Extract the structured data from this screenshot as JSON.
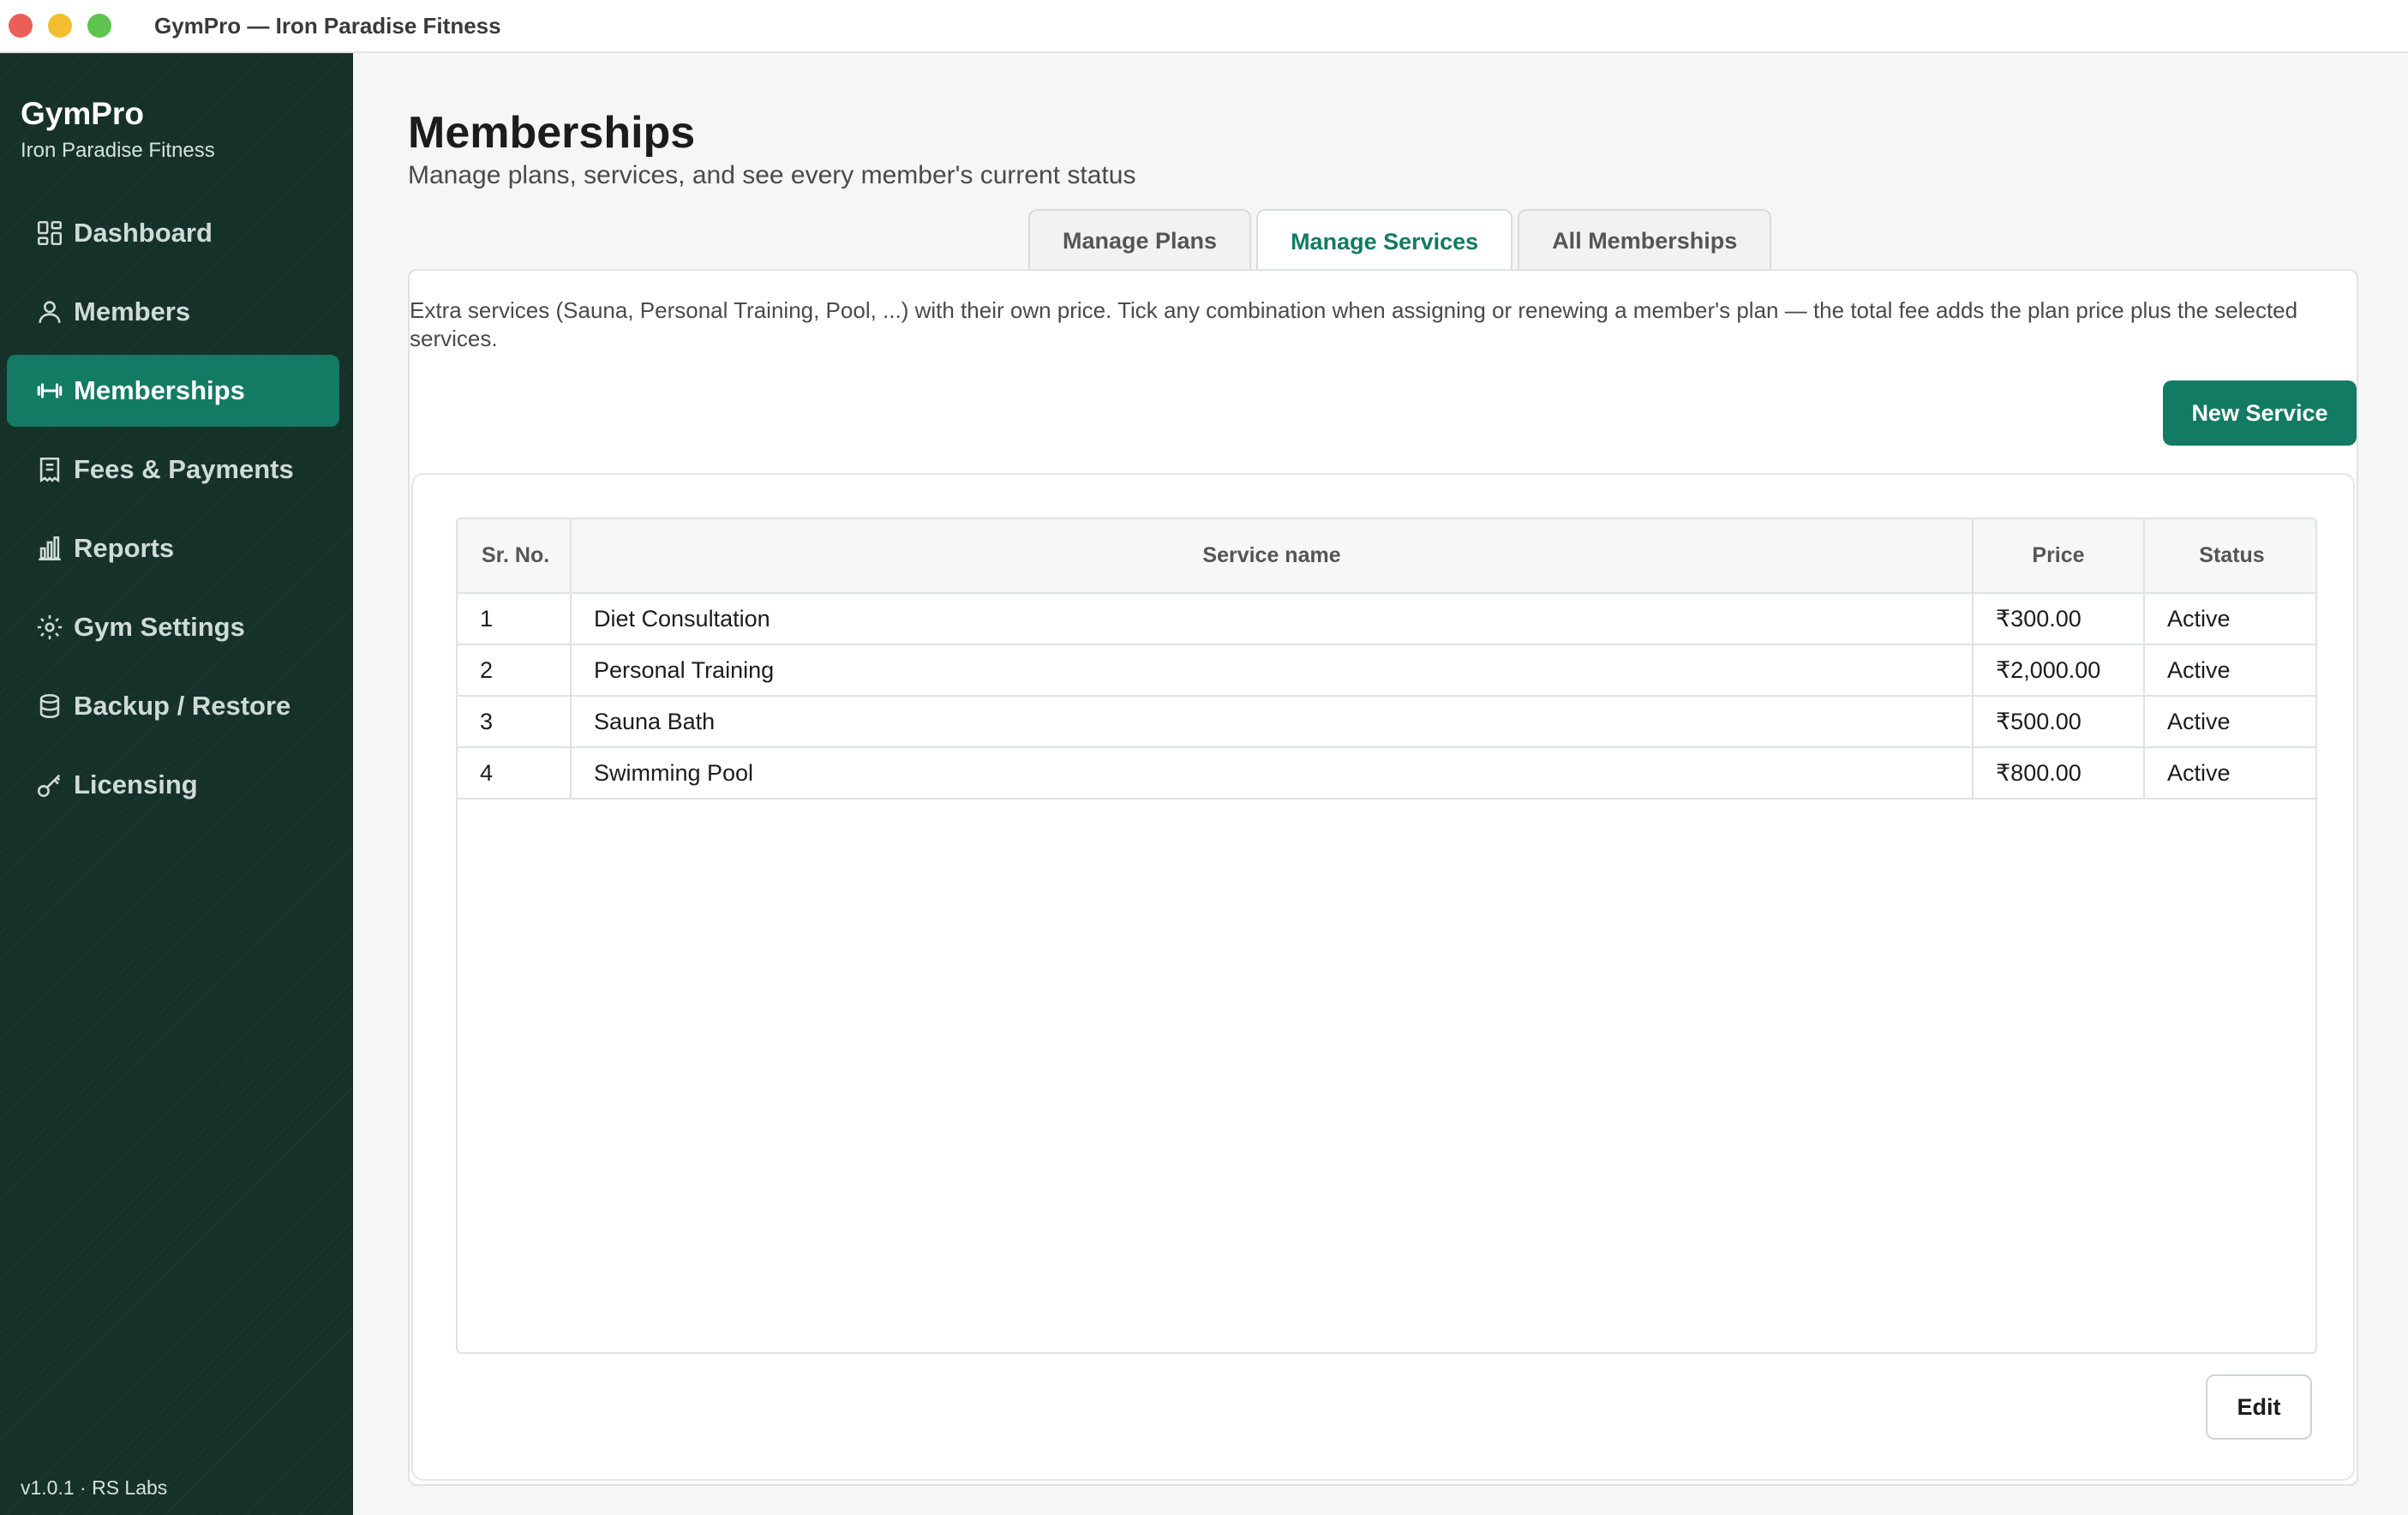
{
  "window": {
    "title": "GymPro — Iron Paradise Fitness"
  },
  "sidebar": {
    "brand": "GymPro",
    "gym_name": "Iron Paradise Fitness",
    "items": [
      {
        "label": "Dashboard",
        "icon": "dashboard-icon",
        "active": false
      },
      {
        "label": "Members",
        "icon": "user-icon",
        "active": false
      },
      {
        "label": "Memberships",
        "icon": "dumbbell-icon",
        "active": true
      },
      {
        "label": "Fees & Payments",
        "icon": "receipt-icon",
        "active": false
      },
      {
        "label": "Reports",
        "icon": "bar-chart-icon",
        "active": false
      },
      {
        "label": "Gym Settings",
        "icon": "gear-icon",
        "active": false
      },
      {
        "label": "Backup / Restore",
        "icon": "database-icon",
        "active": false
      },
      {
        "label": "Licensing",
        "icon": "key-icon",
        "active": false
      }
    ],
    "version": "v1.0.1 · RS Labs"
  },
  "page": {
    "title": "Memberships",
    "subtitle": "Manage plans, services, and see every member's current status"
  },
  "tabs": [
    {
      "label": "Manage Plans",
      "active": false
    },
    {
      "label": "Manage Services",
      "active": true
    },
    {
      "label": "All Memberships",
      "active": false
    }
  ],
  "services_panel": {
    "info_text": "Extra services (Sauna, Personal Training, Pool, ...) with their own price. Tick any combination when assigning or renewing a member's plan — the total fee adds the plan price plus the selected services.",
    "new_button": "New Service",
    "edit_button": "Edit",
    "table": {
      "columns": [
        "Sr. No.",
        "Service name",
        "Price",
        "Status"
      ],
      "rows": [
        {
          "sr": "1",
          "name": "Diet Consultation",
          "price": "₹300.00",
          "status": "Active"
        },
        {
          "sr": "2",
          "name": "Personal Training",
          "price": "₹2,000.00",
          "status": "Active"
        },
        {
          "sr": "3",
          "name": "Sauna Bath",
          "price": "₹500.00",
          "status": "Active"
        },
        {
          "sr": "4",
          "name": "Swimming Pool",
          "price": "₹800.00",
          "status": "Active"
        }
      ]
    }
  },
  "colors": {
    "accent": "#137a63",
    "sidebar_bg": "#16302a"
  }
}
